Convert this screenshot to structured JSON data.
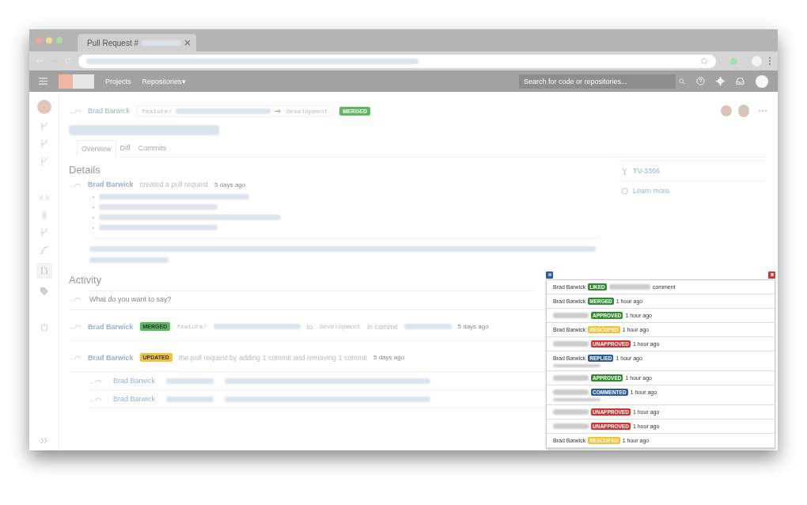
{
  "browser": {
    "tab_title": "Pull Request #",
    "search_placeholder": "Search for code or repositories..."
  },
  "nav": {
    "items": [
      "Projects",
      "Repositories"
    ],
    "dropdown_caret": "▾"
  },
  "pr": {
    "author": "Brad Barwick",
    "source_branch": "feature/",
    "target_branch": "development",
    "status": "MERGED"
  },
  "tabs": [
    {
      "label": "Overview",
      "selected": true
    },
    {
      "label": "Diff",
      "selected": false
    },
    {
      "label": "Commits",
      "selected": false
    }
  ],
  "details": {
    "heading": "Details",
    "author": "Brad Barwick",
    "action": "created a pull request",
    "time": "5 days ago"
  },
  "side_panel": {
    "issue": "TV-3366",
    "learn_more": "Learn more"
  },
  "activity": {
    "heading": "Activity",
    "placeholder": "What do you want to say?",
    "events": [
      {
        "kind": "merge",
        "author": "Brad Barwick",
        "badge": "MERGED",
        "color": "#5cb85c",
        "branch": "feature/",
        "to": "to",
        "target": "development",
        "in_commit": "in commit",
        "time": "5 days ago"
      },
      {
        "kind": "update",
        "author": "Brad Barwick",
        "badge": "UPDATED",
        "color": "#f0c040",
        "text": "the pull request by adding 1 commit and removing 1 commit",
        "time": "5 days ago"
      }
    ],
    "commits": [
      {
        "author": "Brad Barwick"
      },
      {
        "author": "Brad Barwick"
      }
    ]
  },
  "notifications": [
    {
      "author": "Brad Barwick",
      "author_hidden": false,
      "badge": "LIKED",
      "color": "#2e8b2e",
      "time": "comment",
      "has_note": false
    },
    {
      "author": "Brad Barwick",
      "author_hidden": false,
      "badge": "MERGED",
      "color": "#2e8b2e",
      "time": "1 hour ago",
      "has_note": false
    },
    {
      "author_hidden": true,
      "badge": "APPROVED",
      "color": "#2e8b2e",
      "time": "1 hour ago",
      "has_note": false
    },
    {
      "author": "Brad Barwick",
      "author_hidden": false,
      "badge": "RESCOPED",
      "color": "#f2c230",
      "time": "1 hour ago",
      "has_note": false
    },
    {
      "author_hidden": true,
      "badge": "UNAPPROVED",
      "color": "#d93030",
      "time": "1 hour ago",
      "has_note": false
    },
    {
      "author": "Brad Barwick",
      "author_hidden": false,
      "badge": "REPLIED",
      "color": "#2b5c96",
      "time": "1 hour ago",
      "has_note": true
    },
    {
      "author_hidden": true,
      "badge": "APPROVED",
      "color": "#2e8b2e",
      "time": "1 hour ago",
      "has_note": false
    },
    {
      "author_hidden": true,
      "badge": "COMMENTED",
      "color": "#2b5c96",
      "time": "1 hour ago",
      "has_note": true
    },
    {
      "author_hidden": true,
      "badge": "UNAPPROVED",
      "color": "#d93030",
      "time": "1 hour ago",
      "has_note": false
    },
    {
      "author_hidden": true,
      "badge": "UNAPPROVED",
      "color": "#d93030",
      "time": "1 hour ago",
      "has_note": false
    },
    {
      "author": "Brad Barwick",
      "author_hidden": false,
      "badge": "RESCOPED",
      "color": "#f2c230",
      "time": "1 hour ago",
      "has_note": false
    }
  ]
}
